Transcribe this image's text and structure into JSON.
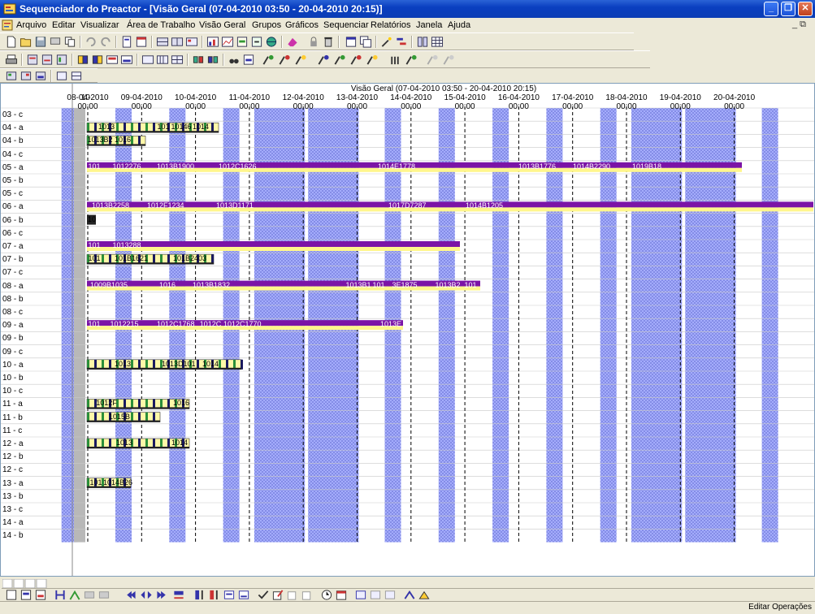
{
  "window": {
    "title": "Sequenciador do Preactor - [Visão Geral   (07-04-2010 03:50 - 20-04-2010 20:15)]",
    "doc_menu_right": "_ ⧉"
  },
  "menu": [
    "Arquivo",
    "Editar",
    "Visualizar",
    "Área de Trabalho",
    "Visão Geral",
    "Grupos",
    "Gráficos",
    "Sequenciar",
    "Relatórios",
    "Janela",
    "Ajuda"
  ],
  "gantt": {
    "header_title": "Visão Geral  (07-04-2010 03:50 - 20-04-2010 20:15)",
    "first_label": "10",
    "dates": [
      {
        "date": "08-04-2010",
        "time": "00:00"
      },
      {
        "date": "09-04-2010",
        "time": "00:00"
      },
      {
        "date": "10-04-2010",
        "time": "00:00"
      },
      {
        "date": "11-04-2010",
        "time": "00:00"
      },
      {
        "date": "12-04-2010",
        "time": "00:00"
      },
      {
        "date": "13-04-2010",
        "time": "00:00"
      },
      {
        "date": "14-04-2010",
        "time": "00:00"
      },
      {
        "date": "15-04-2010",
        "time": "00:00"
      },
      {
        "date": "16-04-2010",
        "time": "00:00"
      },
      {
        "date": "17-04-2010",
        "time": "00:00"
      },
      {
        "date": "18-04-2010",
        "time": "00:00"
      },
      {
        "date": "19-04-2010",
        "time": "00:00"
      },
      {
        "date": "20-04-2010",
        "time": "00:00"
      }
    ],
    "rows": [
      "03 - c",
      "04 - a",
      "04 - b",
      "04 - c",
      "05 - a",
      "05 - b",
      "05 - c",
      "06 - a",
      "06 - b",
      "06 - c",
      "07 - a",
      "07 - b",
      "07 - c",
      "08 - a",
      "08 - b",
      "08 - c",
      "09 - a",
      "09 - b",
      "09 - c",
      "10 - a",
      "10 - b",
      "10 - c",
      "11 - a",
      "11 - b",
      "11 - c",
      "12 - a",
      "12 - b",
      "12 - c",
      "13 - a",
      "13 - b",
      "13 - c",
      "14 - a",
      "14 - b"
    ],
    "bar_labels": {
      "r04a": [
        "1013",
        "101",
        "10146",
        "1014"
      ],
      "r04b": [
        "1013B2",
        "1016"
      ],
      "r05a": [
        "101",
        "1012276",
        "1013B1900",
        "1012C1626",
        "1014E1778",
        "1013B1776",
        "1014B2290",
        "1019B18"
      ],
      "r06a": [
        "1013B2258",
        "1012F1234",
        "1013D1171",
        "1017D7287",
        "1014B1205"
      ],
      "r06b": [
        "10"
      ],
      "r07a": [
        "101",
        "1013288"
      ],
      "r07b": [
        "101",
        "101B1621",
        "101B2403"
      ],
      "r08a": [
        "1009B1035",
        "1016",
        "1013B1832",
        "1013B1",
        "101",
        "3E1875",
        "1013B2",
        "101"
      ],
      "r09a": [
        "101",
        "1012215",
        "1012C1768",
        "1012C",
        "1012C1770",
        "1013E"
      ],
      "r10a": [
        "1013",
        "1013D101",
        "1014"
      ],
      "r11a": [
        "1012F",
        "1016"
      ],
      "r11b": [
        "1015B"
      ],
      "r12a": [
        "1013",
        "1014"
      ],
      "r13a": [
        "101",
        "1014B26"
      ]
    }
  },
  "status": {
    "text": "Editar Operações"
  },
  "colors": {
    "accent": "#0a3fc0",
    "bar_purple": "#7b14a6",
    "bar_yellow": "#fff68c",
    "bar_red": "#e0001a",
    "calendar_blue": "#9aa6ff"
  }
}
